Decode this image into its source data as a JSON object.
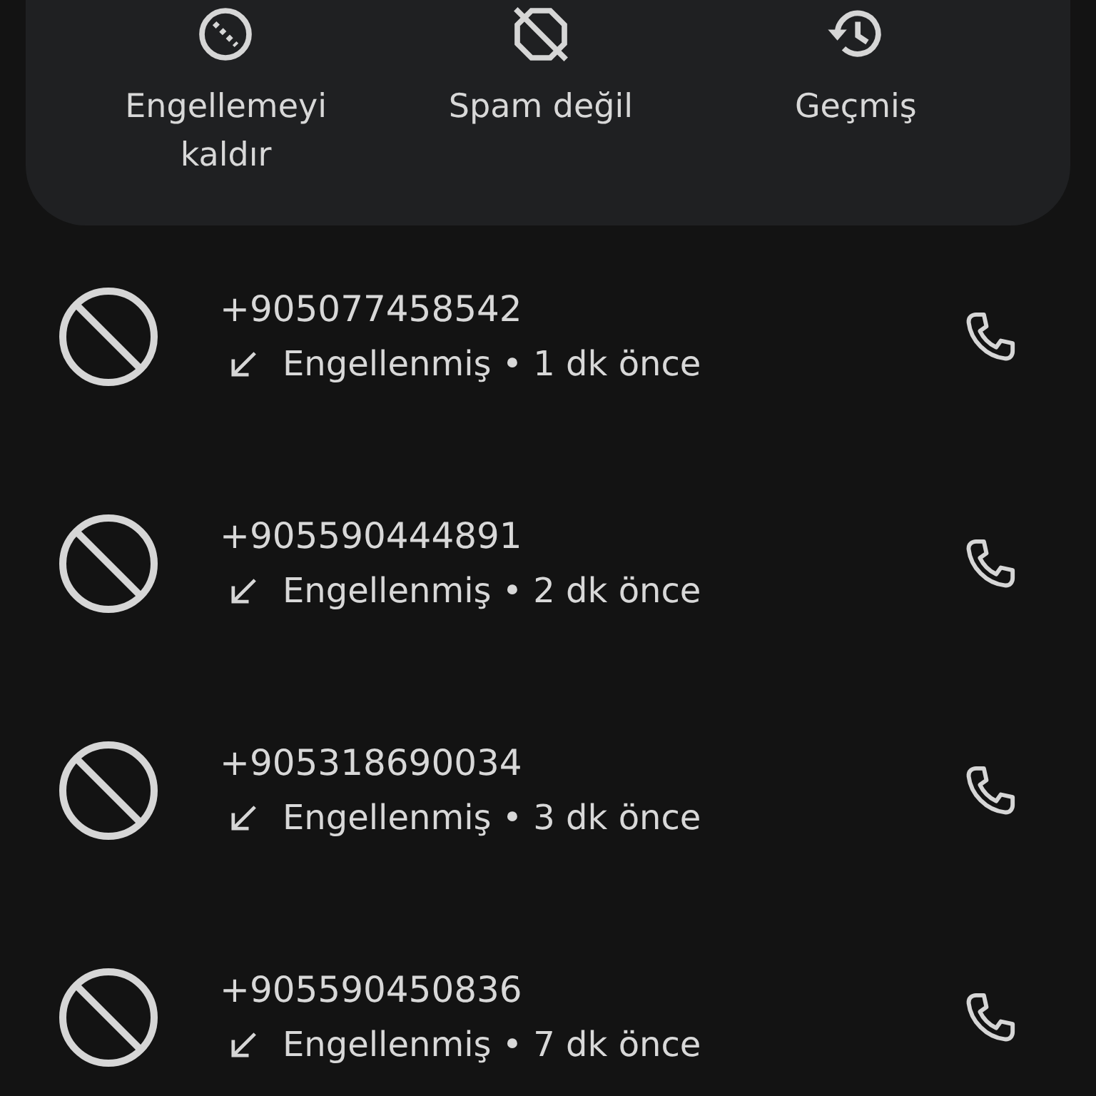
{
  "actions": [
    {
      "kind": "unblock",
      "label": "Engellemeyi kaldır"
    },
    {
      "kind": "not_spam",
      "label": "Spam değil"
    },
    {
      "kind": "history",
      "label": "Geçmiş"
    }
  ],
  "calls": [
    {
      "number": "+905077458542",
      "status": "Engellenmiş • 1 dk önce"
    },
    {
      "number": "+905590444891",
      "status": "Engellenmiş • 2 dk önce"
    },
    {
      "number": "+905318690034",
      "status": "Engellenmiş • 3 dk önce"
    },
    {
      "number": "+905590450836",
      "status": "Engellenmiş • 7 dk önce"
    }
  ]
}
